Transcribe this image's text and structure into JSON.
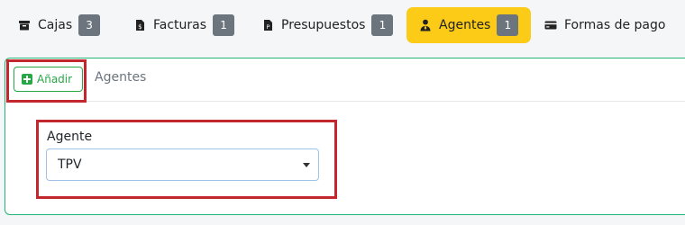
{
  "tabs": [
    {
      "label": "Cajas",
      "icon": "box-icon",
      "badge": "3"
    },
    {
      "label": "Facturas",
      "icon": "invoice-icon",
      "badge": "1"
    },
    {
      "label": "Presupuestos",
      "icon": "document-icon",
      "badge": "1"
    },
    {
      "label": "Agentes",
      "icon": "user-tie-icon",
      "badge": "1",
      "active": true
    },
    {
      "label": "Formas de pago",
      "icon": "credit-card-icon"
    }
  ],
  "card": {
    "add_button_label": "Añadir",
    "title": "Agentes"
  },
  "form": {
    "agent_label": "Agente",
    "agent_value": "TPV"
  },
  "colors": {
    "active_tab": "#fbcb17",
    "badge": "#6c757d",
    "success": "#28a745",
    "highlight": "#c1272d"
  }
}
